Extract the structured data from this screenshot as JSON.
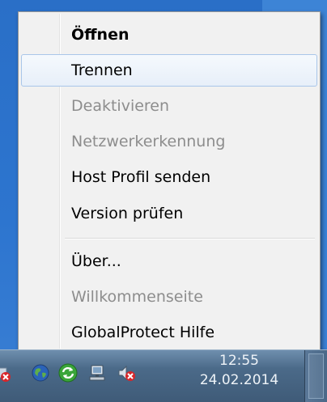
{
  "menu": {
    "items": [
      {
        "label": "Öffnen",
        "style": "bold"
      },
      {
        "label": "Trennen",
        "state": "hover"
      },
      {
        "label": "Deaktivieren",
        "state": "disabled"
      },
      {
        "label": "Netzwerkerkennung",
        "state": "disabled"
      },
      {
        "label": "Host Profil senden"
      },
      {
        "label": "Version prüfen"
      },
      {
        "label": "Über..."
      },
      {
        "label": "Willkommenseite",
        "state": "disabled"
      },
      {
        "label": "GlobalProtect Hilfe"
      }
    ]
  },
  "taskbar": {
    "tray_icons": [
      "network-error-icon",
      "globalprotect-globe-icon",
      "sync-icon",
      "network-monitor-icon",
      "speaker-muted-icon"
    ],
    "clock": {
      "time": "12:55",
      "date": "24.02.2014"
    }
  },
  "colors": {
    "desktop": "#2d75cf",
    "menu_background": "#f1f1f1",
    "hover_border": "#a9c6e9",
    "disabled_text": "#8d8d8d",
    "taskbar": "#4b6a89"
  }
}
